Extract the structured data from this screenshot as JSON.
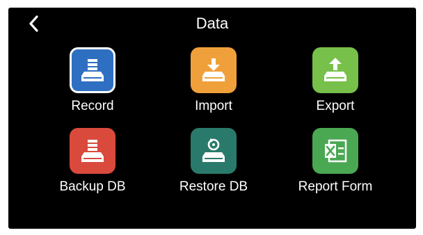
{
  "header": {
    "title": "Data",
    "back_icon": "chevron-left-icon"
  },
  "tiles": [
    {
      "label": "Record",
      "icon": "record-icon",
      "color": "#2f6fc2",
      "selected": true
    },
    {
      "label": "Import",
      "icon": "import-icon",
      "color": "#f0a03a",
      "selected": false
    },
    {
      "label": "Export",
      "icon": "export-icon",
      "color": "#77c04a",
      "selected": false
    },
    {
      "label": "Backup DB",
      "icon": "backup-db-icon",
      "color": "#d94a3d",
      "selected": false
    },
    {
      "label": "Restore DB",
      "icon": "restore-db-icon",
      "color": "#2a7a6b",
      "selected": false
    },
    {
      "label": "Report Form",
      "icon": "excel-report-icon",
      "color": "#4aa852",
      "selected": false
    }
  ]
}
